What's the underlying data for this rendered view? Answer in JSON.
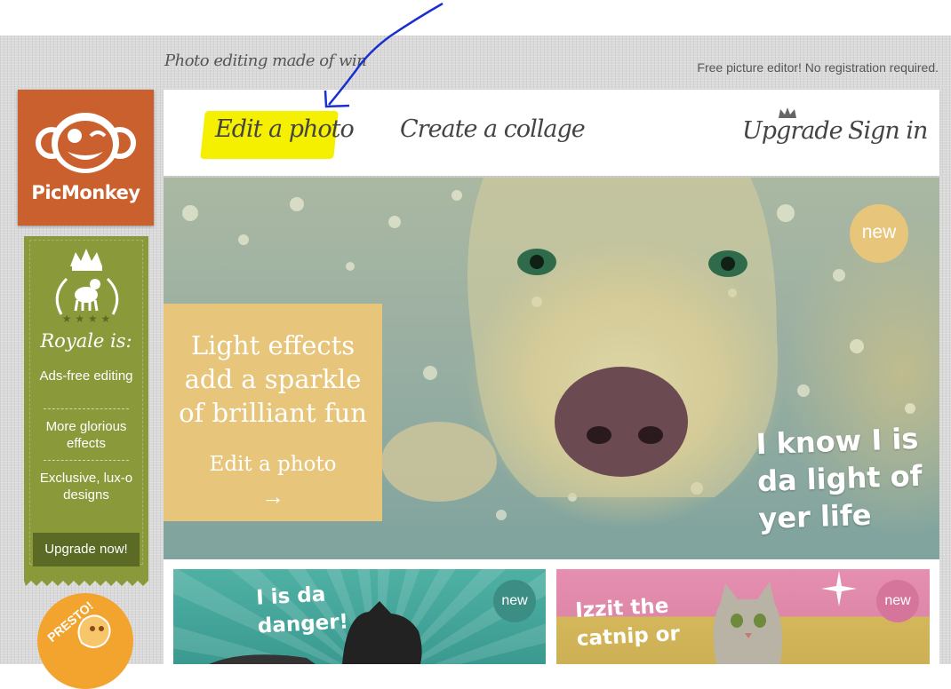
{
  "header": {
    "tagline": "Photo editing made of win",
    "free_text": "Free picture editor! No registration required."
  },
  "logo": {
    "name": "PicMonkey"
  },
  "nav": {
    "edit": "Edit a photo",
    "collage": "Create a collage",
    "upgrade": "Upgrade",
    "signin": "Sign in"
  },
  "royale": {
    "title": "Royale is:",
    "features": [
      "Ads-free editing",
      "More glorious effects",
      "Exclusive, lux-o designs"
    ],
    "cta": "Upgrade now!"
  },
  "presto": {
    "label": "PRESTO!"
  },
  "hero": {
    "title": "Light effects\nadd a sparkle\nof brilliant fun",
    "link": "Edit a photo",
    "arrow": "→",
    "badge": "new",
    "quote": "I know I is\nda light of\nyer life"
  },
  "cards": [
    {
      "text": "I is da\ndanger!",
      "badge": "new"
    },
    {
      "text": "Izzit the\ncatnip or",
      "badge": "new"
    }
  ],
  "colors": {
    "logo": "#c9602e",
    "royale": "#8a9a3b",
    "hero_caption": "#e7c57a",
    "highlight": "#f5f000",
    "annotation": "#1a2fd0"
  }
}
